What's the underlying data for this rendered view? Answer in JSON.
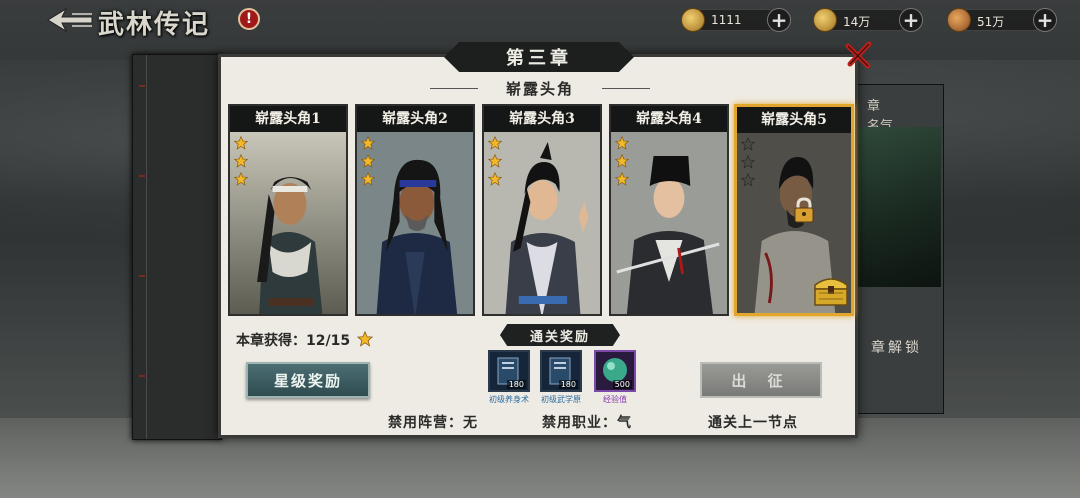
{
  "header": {
    "title": "武林传记",
    "alert_symbol": "!",
    "resources": [
      {
        "icon": "ingot-icon",
        "value": "1111"
      },
      {
        "icon": "coin-icon",
        "value": "14万"
      },
      {
        "icon": "money-bag-icon",
        "value": "51万"
      }
    ]
  },
  "chapter": {
    "title": "第三章",
    "subtitle": "崭露头角",
    "stages": [
      {
        "name": "崭露头角1",
        "stars": 3,
        "locked": false,
        "selected": false
      },
      {
        "name": "崭露头角2",
        "stars": 3,
        "locked": false,
        "selected": false
      },
      {
        "name": "崭露头角3",
        "stars": 3,
        "locked": false,
        "selected": false
      },
      {
        "name": "崭露头角4",
        "stars": 3,
        "locked": false,
        "selected": false
      },
      {
        "name": "崭露头角5",
        "stars": 0,
        "locked": true,
        "selected": true
      }
    ],
    "progress_label": "本章获得：12/15",
    "star_reward_button": "星级奖励",
    "clear_reward_title": "通关奖励",
    "rewards": [
      {
        "name": "初级养身术",
        "qty": "180"
      },
      {
        "name": "初级武学原",
        "qty": "180"
      },
      {
        "name": "经验值",
        "qty": "500"
      }
    ],
    "go_button": "出 征",
    "restriction_faction": "禁用阵营：无",
    "restriction_class": "禁用职业：气",
    "unlock_hint": "通关上一节点"
  },
  "side_book": {
    "line1": "章",
    "line2": "名气",
    "unlock_text": "章解锁"
  },
  "colors": {
    "panel_bg": "#eeebe4",
    "selected_border": "#e2a62c",
    "star_gold": "#f2b82a",
    "button_teal": "#3e5d62",
    "button_disabled": "#8a8a86"
  }
}
